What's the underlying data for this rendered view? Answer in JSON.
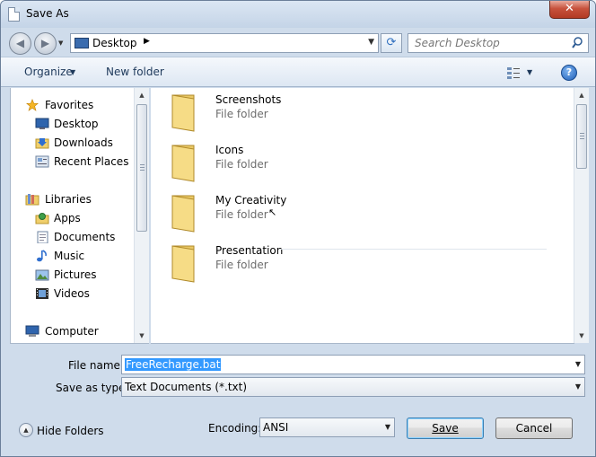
{
  "window": {
    "title": "Save As",
    "close_label": "✕"
  },
  "navigation": {
    "back_label": "◀",
    "forward_label": "▶",
    "history_drop": "▼",
    "address": {
      "location": "Desktop",
      "separator": "▶",
      "dropdown": "▼"
    },
    "refresh_label": "⟳",
    "search_placeholder": "Search Desktop"
  },
  "toolbar": {
    "organize_label": "Organize",
    "organize_drop": "▼",
    "new_folder_label": "New folder",
    "view_drop": "▼",
    "help_label": "?"
  },
  "sidebar": {
    "items": [
      {
        "label": "Favorites",
        "icon": "star-icon"
      },
      {
        "label": "Desktop",
        "icon": "desktop-icon"
      },
      {
        "label": "Downloads",
        "icon": "downloads-icon"
      },
      {
        "label": "Recent Places",
        "icon": "recent-places-icon"
      },
      {
        "label": "Libraries",
        "icon": "libraries-icon"
      },
      {
        "label": "Apps",
        "icon": "apps-icon"
      },
      {
        "label": "Documents",
        "icon": "documents-icon"
      },
      {
        "label": "Music",
        "icon": "music-icon"
      },
      {
        "label": "Pictures",
        "icon": "pictures-icon"
      },
      {
        "label": "Videos",
        "icon": "videos-icon"
      },
      {
        "label": "Computer",
        "icon": "computer-icon"
      }
    ]
  },
  "files": [
    {
      "name": "Screenshots",
      "type": "File folder"
    },
    {
      "name": "Icons",
      "type": "File folder"
    },
    {
      "name": "My Creativity",
      "type": "File folder"
    },
    {
      "name": "Presentation",
      "type": "File folder"
    }
  ],
  "form": {
    "file_name_label": "File name:",
    "file_name_value": "FreeRecharge.bat",
    "save_type_label": "Save as type:",
    "save_type_value": "Text Documents (*.txt)",
    "encoding_label": "Encoding:",
    "encoding_value": "ANSI",
    "dropdown_arrow": "▼"
  },
  "footer": {
    "hide_folders_label": "Hide Folders",
    "hide_folders_arrow": "▲",
    "save_label": "Save",
    "cancel_label": "Cancel"
  },
  "colors": {
    "frame": "#cfdceb",
    "selection": "#3399ff",
    "close_button": "#c7523c",
    "link_text": "#1e395b"
  }
}
